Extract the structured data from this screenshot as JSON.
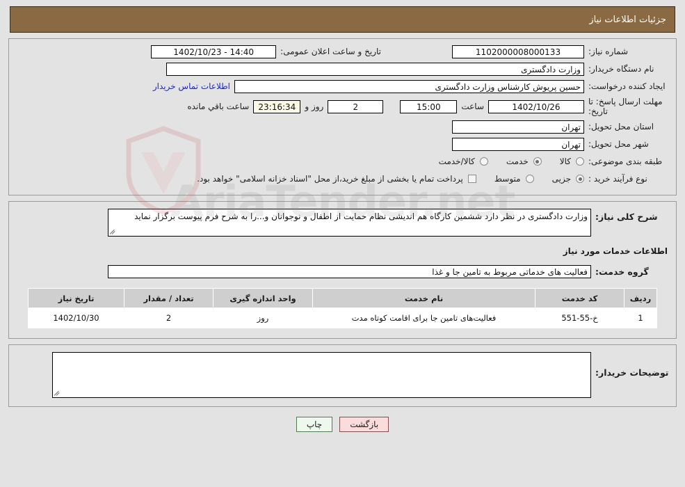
{
  "header": {
    "title": "جزئیات اطلاعات نیاز"
  },
  "top_section": {
    "need_number_label": "شماره نیاز:",
    "need_number_value": "1102000008000133",
    "public_announce_label": "تاریخ و ساعت اعلان عمومی:",
    "public_announce_value": "14:40 - 1402/10/23",
    "buyer_org_label": "نام دستگاه خریدار:",
    "buyer_org_value": "وزارت دادگستری",
    "creator_label": "ایجاد کننده درخواست:",
    "creator_value": "حسین پریوش کارشناس وزارت دادگستری",
    "contact_link": "اطلاعات تماس خریدار",
    "deadline_label": "مهلت ارسال پاسخ: تا تاریخ:",
    "deadline_date": "1402/10/26",
    "hour_label": "ساعت",
    "hour_value": "15:00",
    "days_value": "2",
    "days_label": "روز و",
    "countdown_value": "23:16:34",
    "countdown_label": "ساعت باقي مانده",
    "province_label": "استان محل تحویل:",
    "province_value": "تهران",
    "city_label": "شهر محل تحویل:",
    "city_value": "تهران",
    "category_label": "طبقه بندی موضوعی:",
    "category_options": [
      {
        "label": "کالا",
        "checked": false
      },
      {
        "label": "خدمت",
        "checked": true
      },
      {
        "label": "کالا/خدمت",
        "checked": false
      }
    ],
    "process_label": "نوع فرآیند خرید :",
    "process_options": [
      {
        "label": "جزیی",
        "checked": true
      },
      {
        "label": "متوسط",
        "checked": false
      }
    ],
    "treasury_note": "پرداخت تمام یا بخشی از مبلغ خرید،از محل \"اسناد خزانه اسلامی\" خواهد بود."
  },
  "mid_section": {
    "general_desc_label": "شرح کلی نیاز:",
    "general_desc_value": "وزارت دادگستری در نظر دارد ششمین کارگاه هم اندیشی نظام حمایت از اطفال و نوجوانان و...را به شرح فرم پیوست برگزار نماید",
    "services_heading": "اطلاعات خدمات مورد نیاز",
    "service_group_label": "گروه خدمت:",
    "service_group_value": "فعالیت های خدماتی مربوط به تامین جا و غذا",
    "table": {
      "headers": [
        "ردیف",
        "کد خدمت",
        "نام خدمت",
        "واحد اندازه گیری",
        "تعداد / مقدار",
        "تاریخ نیاز"
      ],
      "rows": [
        {
          "radif": "1",
          "code": "خ-55-551",
          "name": "فعالیت‌های تامین جا برای اقامت کوتاه مدت",
          "unit": "روز",
          "qty": "2",
          "date": "1402/10/30"
        }
      ]
    }
  },
  "bottom_section": {
    "buyer_notes_label": "توضیحات خریدار:",
    "buyer_notes_value": ""
  },
  "buttons": {
    "print": "چاپ",
    "back": "بازگشت"
  },
  "watermark": {
    "text": "AriaTender.net"
  },
  "colors": {
    "header_bg": "#8a6a42",
    "page_bg": "#e3e3e3",
    "link": "#1c27d0",
    "table_header_bg": "#cfcfcf",
    "countdown_bg": "#fbfbe8",
    "btn_print_bg": "#eef8ee",
    "btn_back_bg": "#fadcdc"
  }
}
